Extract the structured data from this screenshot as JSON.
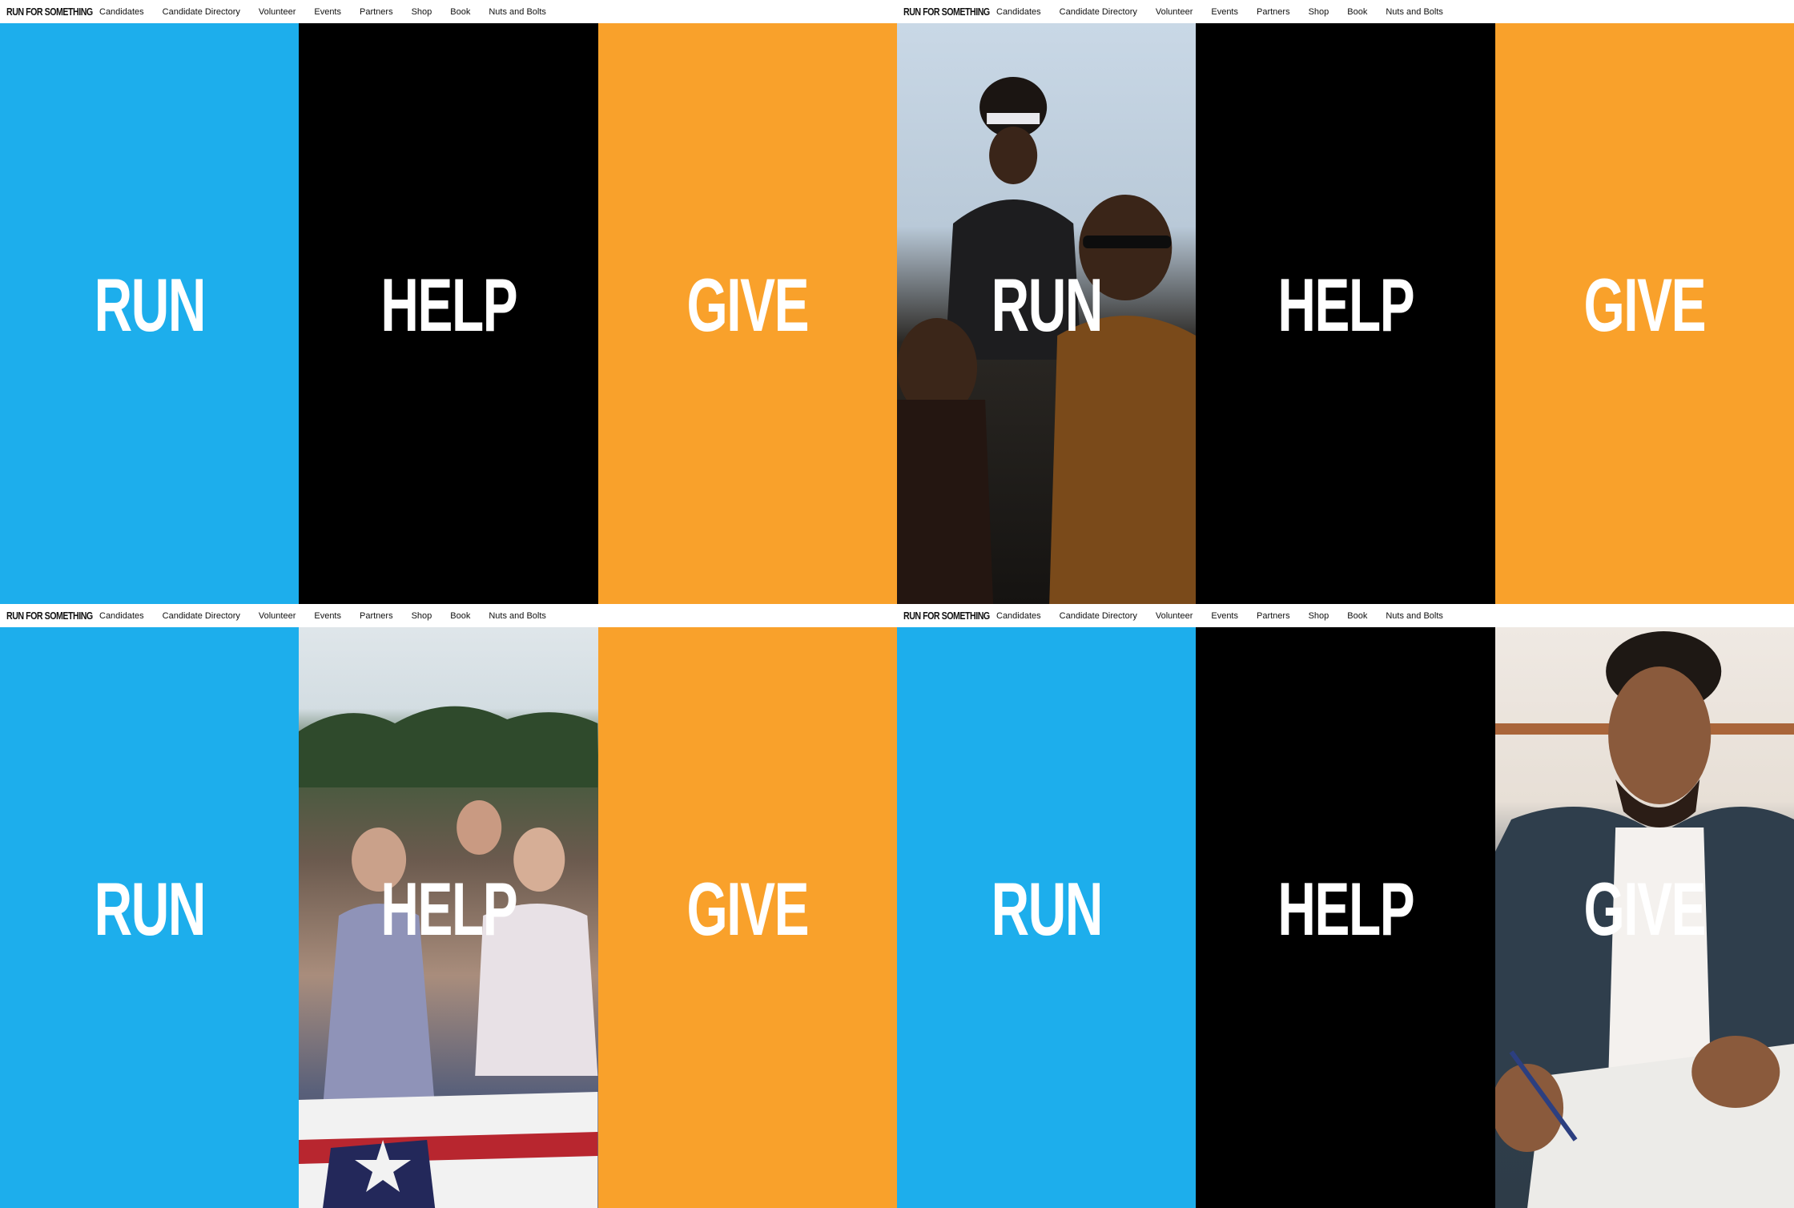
{
  "site": {
    "logo": "RUN FOR SOMETHING"
  },
  "nav": [
    {
      "label": "Candidates"
    },
    {
      "label": "Candidate Directory"
    },
    {
      "label": "Volunteer"
    },
    {
      "label": "Events"
    },
    {
      "label": "Partners"
    },
    {
      "label": "Shop"
    },
    {
      "label": "Book"
    },
    {
      "label": "Nuts and Bolts"
    }
  ],
  "colors": {
    "run": "#1daeec",
    "help": "#000000",
    "give": "#f9a12b",
    "text": "#ffffff"
  },
  "panels": {
    "run": "RUN",
    "help": "HELP",
    "give": "GIVE"
  },
  "states": [
    {
      "hovered": "none"
    },
    {
      "hovered": "run",
      "photo": "child-on-shoulders-photo"
    },
    {
      "hovered": "help",
      "photo": "rally-crowd-photo"
    },
    {
      "hovered": "give",
      "photo": "man-writing-photo"
    }
  ]
}
